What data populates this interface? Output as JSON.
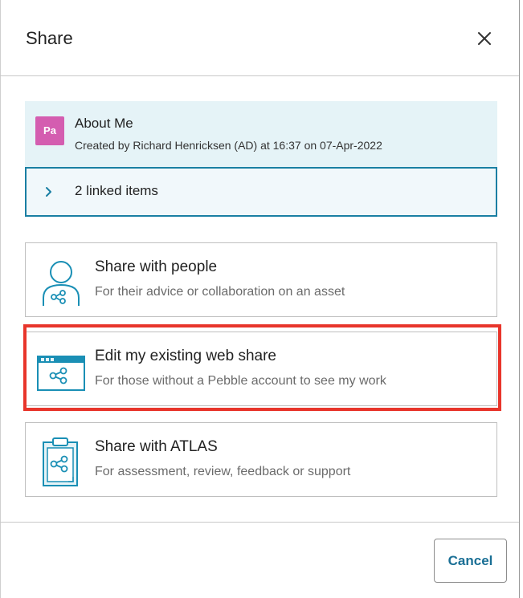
{
  "dialog": {
    "title": "Share"
  },
  "asset": {
    "avatar_initials": "Pa",
    "avatar_color": "#d45db0",
    "title": "About Me",
    "meta": "Created by Richard Henricksen (AD) at 16:37 on 07-Apr-2022",
    "linked_items_label": "2 linked items"
  },
  "options": [
    {
      "title": "Share with people",
      "subtitle": "For their advice or collaboration on an asset",
      "icon": "person-share-icon"
    },
    {
      "title": "Edit my existing web share",
      "subtitle": "For those without a Pebble account to see my work",
      "icon": "web-share-icon",
      "highlighted": true
    },
    {
      "title": "Share with ATLAS",
      "subtitle": "For assessment, review, feedback or support",
      "icon": "clipboard-share-icon"
    }
  ],
  "footer": {
    "cancel_label": "Cancel"
  },
  "colors": {
    "accent": "#1a7fa3",
    "asset_bg": "#e5f3f7",
    "highlight": "#e8352b",
    "icon_stroke": "#1a8fb5"
  }
}
